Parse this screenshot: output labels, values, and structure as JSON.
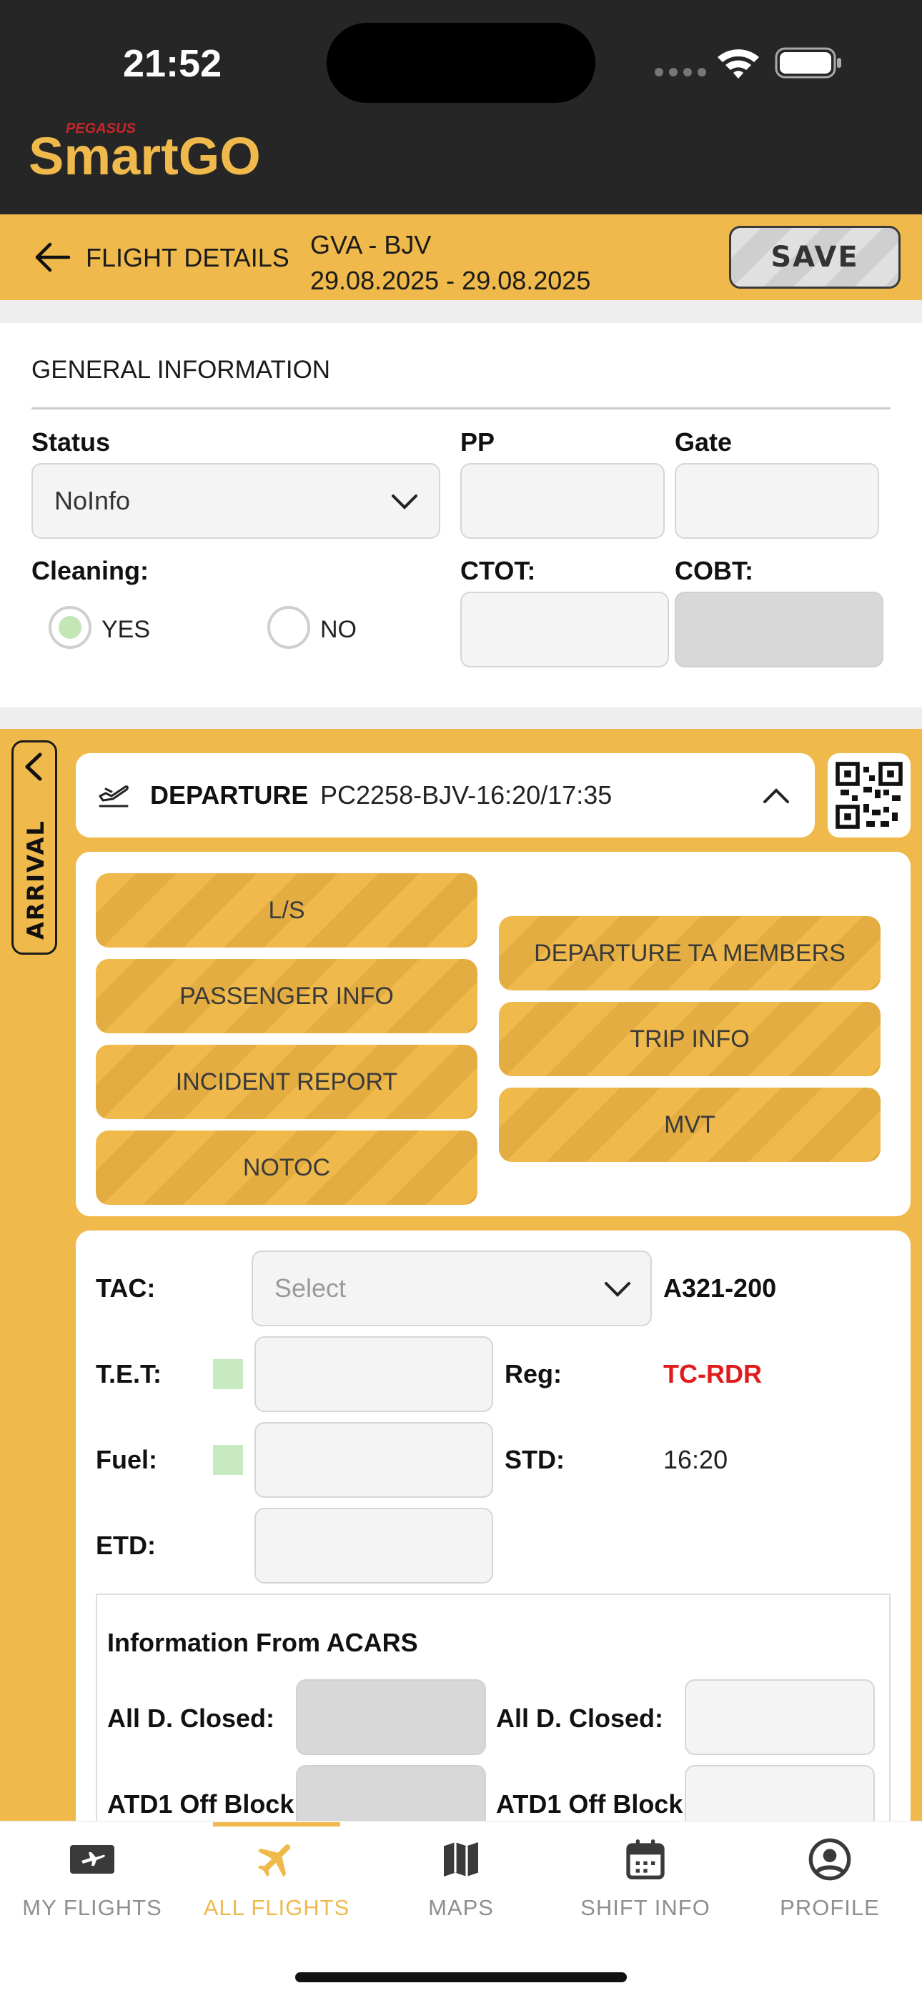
{
  "status_bar": {
    "time": "21:52"
  },
  "brand": {
    "logo_small": "PEGASUS",
    "logo_main": "SmartGO",
    "accent_color": "#f0b94b"
  },
  "header": {
    "title": "FLIGHT DETAILS",
    "route": "GVA - BJV",
    "dates": "29.08.2025 - 29.08.2025",
    "save_label": "SAVE"
  },
  "general": {
    "title": "GENERAL INFORMATION",
    "status_label": "Status",
    "status_value": "NoInfo",
    "pp_label": "PP",
    "gate_label": "Gate",
    "cleaning_label": "Cleaning:",
    "cleaning_yes": "YES",
    "cleaning_no": "NO",
    "cleaning_selected": "YES",
    "ctot_label": "CTOT:",
    "cobt_label": "COBT:"
  },
  "side_tab": {
    "label": "ARRIVAL"
  },
  "departure": {
    "title": "DEPARTURE",
    "flight": "PC2258-BJV-16:20/17:35"
  },
  "action_buttons": {
    "left": [
      "L/S",
      "PASSENGER INFO",
      "INCIDENT REPORT",
      "NOTOC"
    ],
    "right": [
      "DEPARTURE TA MEMBERS",
      "TRIP INFO",
      "MVT"
    ]
  },
  "form": {
    "tac_label": "TAC:",
    "tac_placeholder": "Select",
    "aircraft_type": "A321-200",
    "tet_label": "T.E.T:",
    "reg_label": "Reg:",
    "reg_value": "TC-RDR",
    "reg_color": "#e01b1b",
    "fuel_label": "Fuel:",
    "std_label": "STD:",
    "std_value": "16:20",
    "etd_label": "ETD:"
  },
  "acars": {
    "title": "Information From ACARS",
    "row1_left": "All D. Closed:",
    "row1_right": "All D. Closed:",
    "row2_left": "ATD1 Off Block:",
    "row2_right": "ATD1 Off Block:"
  },
  "tabbar": {
    "items": [
      {
        "label": "MY FLIGHTS",
        "icon": "ticket-plane-icon"
      },
      {
        "label": "ALL FLIGHTS",
        "icon": "airplane-icon",
        "active": true
      },
      {
        "label": "MAPS",
        "icon": "map-icon"
      },
      {
        "label": "SHIFT INFO",
        "icon": "calendar-icon"
      },
      {
        "label": "PROFILE",
        "icon": "user-circle-icon"
      }
    ]
  }
}
